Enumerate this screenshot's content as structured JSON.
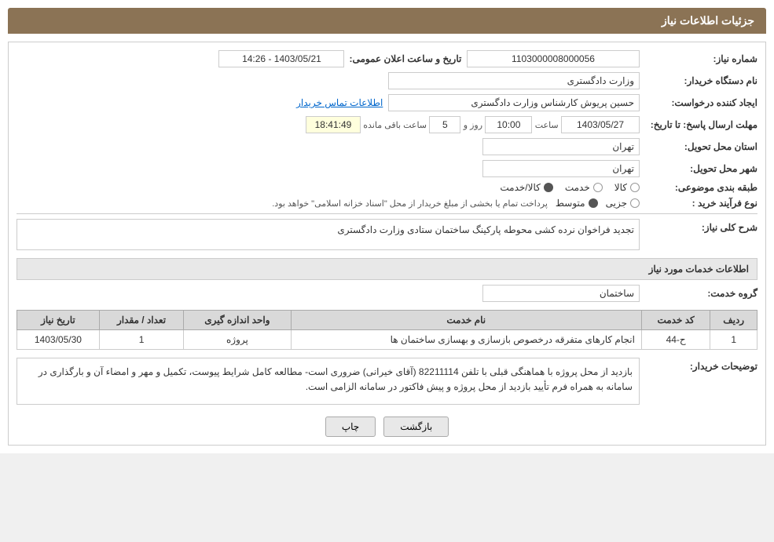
{
  "header": {
    "title": "جزئیات اطلاعات نیاز"
  },
  "fields": {
    "need_number_label": "شماره نیاز:",
    "need_number_value": "1103000008000056",
    "announce_date_label": "تاریخ و ساعت اعلان عمومی:",
    "announce_date_value": "1403/05/21 - 14:26",
    "buyer_org_label": "نام دستگاه خریدار:",
    "buyer_org_value": "وزارت دادگستری",
    "creator_label": "ایجاد کننده درخواست:",
    "creator_value": "حسین پریوش کارشناس وزارت دادگستری",
    "contact_link": "اطلاعات تماس خریدار",
    "response_deadline_label": "مهلت ارسال پاسخ: تا تاریخ:",
    "response_date_value": "1403/05/27",
    "response_time_label": "ساعت",
    "response_time_value": "10:00",
    "response_days_label": "روز و",
    "response_days_value": "5",
    "response_remaining_label": "ساعت باقی مانده",
    "response_remaining_value": "18:41:49",
    "delivery_province_label": "استان محل تحویل:",
    "delivery_province_value": "تهران",
    "delivery_city_label": "شهر محل تحویل:",
    "delivery_city_value": "تهران",
    "category_label": "طبقه بندی موضوعی:",
    "category_options": [
      "کالا",
      "خدمت",
      "کالا/خدمت"
    ],
    "category_selected": "کالا/خدمت",
    "purchase_type_label": "نوع فرآیند خرید :",
    "purchase_type_options": [
      "جزیی",
      "متوسط"
    ],
    "purchase_type_note": "پرداخت تمام یا بخشی از مبلغ خریدار از محل \"اسناد خزانه اسلامی\" خواهد بود.",
    "need_desc_label": "شرح کلی نیاز:",
    "need_desc_value": "تجدید فراخوان نرده کشی محوطه پارکینگ ساختمان ستادی وزارت دادگستری",
    "services_section": "اطلاعات خدمات مورد نیاز",
    "service_group_label": "گروه خدمت:",
    "service_group_value": "ساختمان",
    "table": {
      "columns": [
        "ردیف",
        "کد خدمت",
        "نام خدمت",
        "واحد اندازه گیری",
        "تعداد / مقدار",
        "تاریخ نیاز"
      ],
      "rows": [
        {
          "row_num": "1",
          "service_code": "ح-44",
          "service_name": "انجام کارهای متفرقه درخصوص بازسازی و بهسازی ساختمان ها",
          "unit": "پروژه",
          "quantity": "1",
          "date": "1403/05/30"
        }
      ]
    },
    "buyer_notes_label": "توضیحات خریدار:",
    "buyer_notes_value": "بازدید از محل پروژه با هماهنگی قبلی با تلفن 82211114 (آقای خیرانی) ضروری است- مطالعه کامل شرایط پیوست، تکمیل و مهر و امضاء آن و بارگذاری در سامانه به همراه فرم تأیید بازدید از محل پروژه و پیش فاکتور در سامانه الزامی است.",
    "btn_back": "بازگشت",
    "btn_print": "چاپ"
  }
}
